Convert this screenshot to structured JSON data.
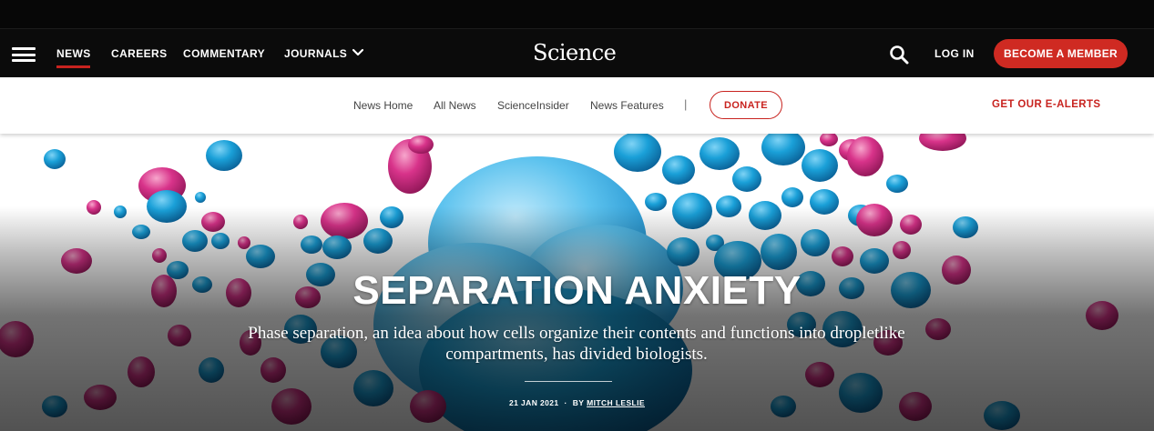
{
  "header": {
    "logo": "Science",
    "nav": [
      {
        "label": "NEWS",
        "active": true
      },
      {
        "label": "CAREERS"
      },
      {
        "label": "COMMENTARY"
      },
      {
        "label": "JOURNALS"
      }
    ],
    "login_label": "LOG IN",
    "member_label": "BECOME A MEMBER",
    "icons": [
      "hamburger-menu-icon",
      "chevron-down-icon",
      "search-icon"
    ]
  },
  "subnav": {
    "links": [
      "News Home",
      "All News",
      "ScienceInsider",
      "News Features"
    ],
    "separator": "|",
    "donate_label": "DONATE",
    "ealerts_label": "GET OUR E-ALERTS"
  },
  "hero": {
    "title": "SEPARATION ANXIETY",
    "dek": "Phase separation, an idea about how cells organize their contents and functions into dropletlike compartments, has divided biologists.",
    "date": "21 JAN 2021",
    "by_prefix": "BY",
    "author": "MITCH LESLIE"
  },
  "colors": {
    "accent_red": "#c8231f",
    "nav_bg": "#0b0b0b",
    "droplet_blue": "#1aa0d8",
    "droplet_magenta": "#d8338a"
  }
}
